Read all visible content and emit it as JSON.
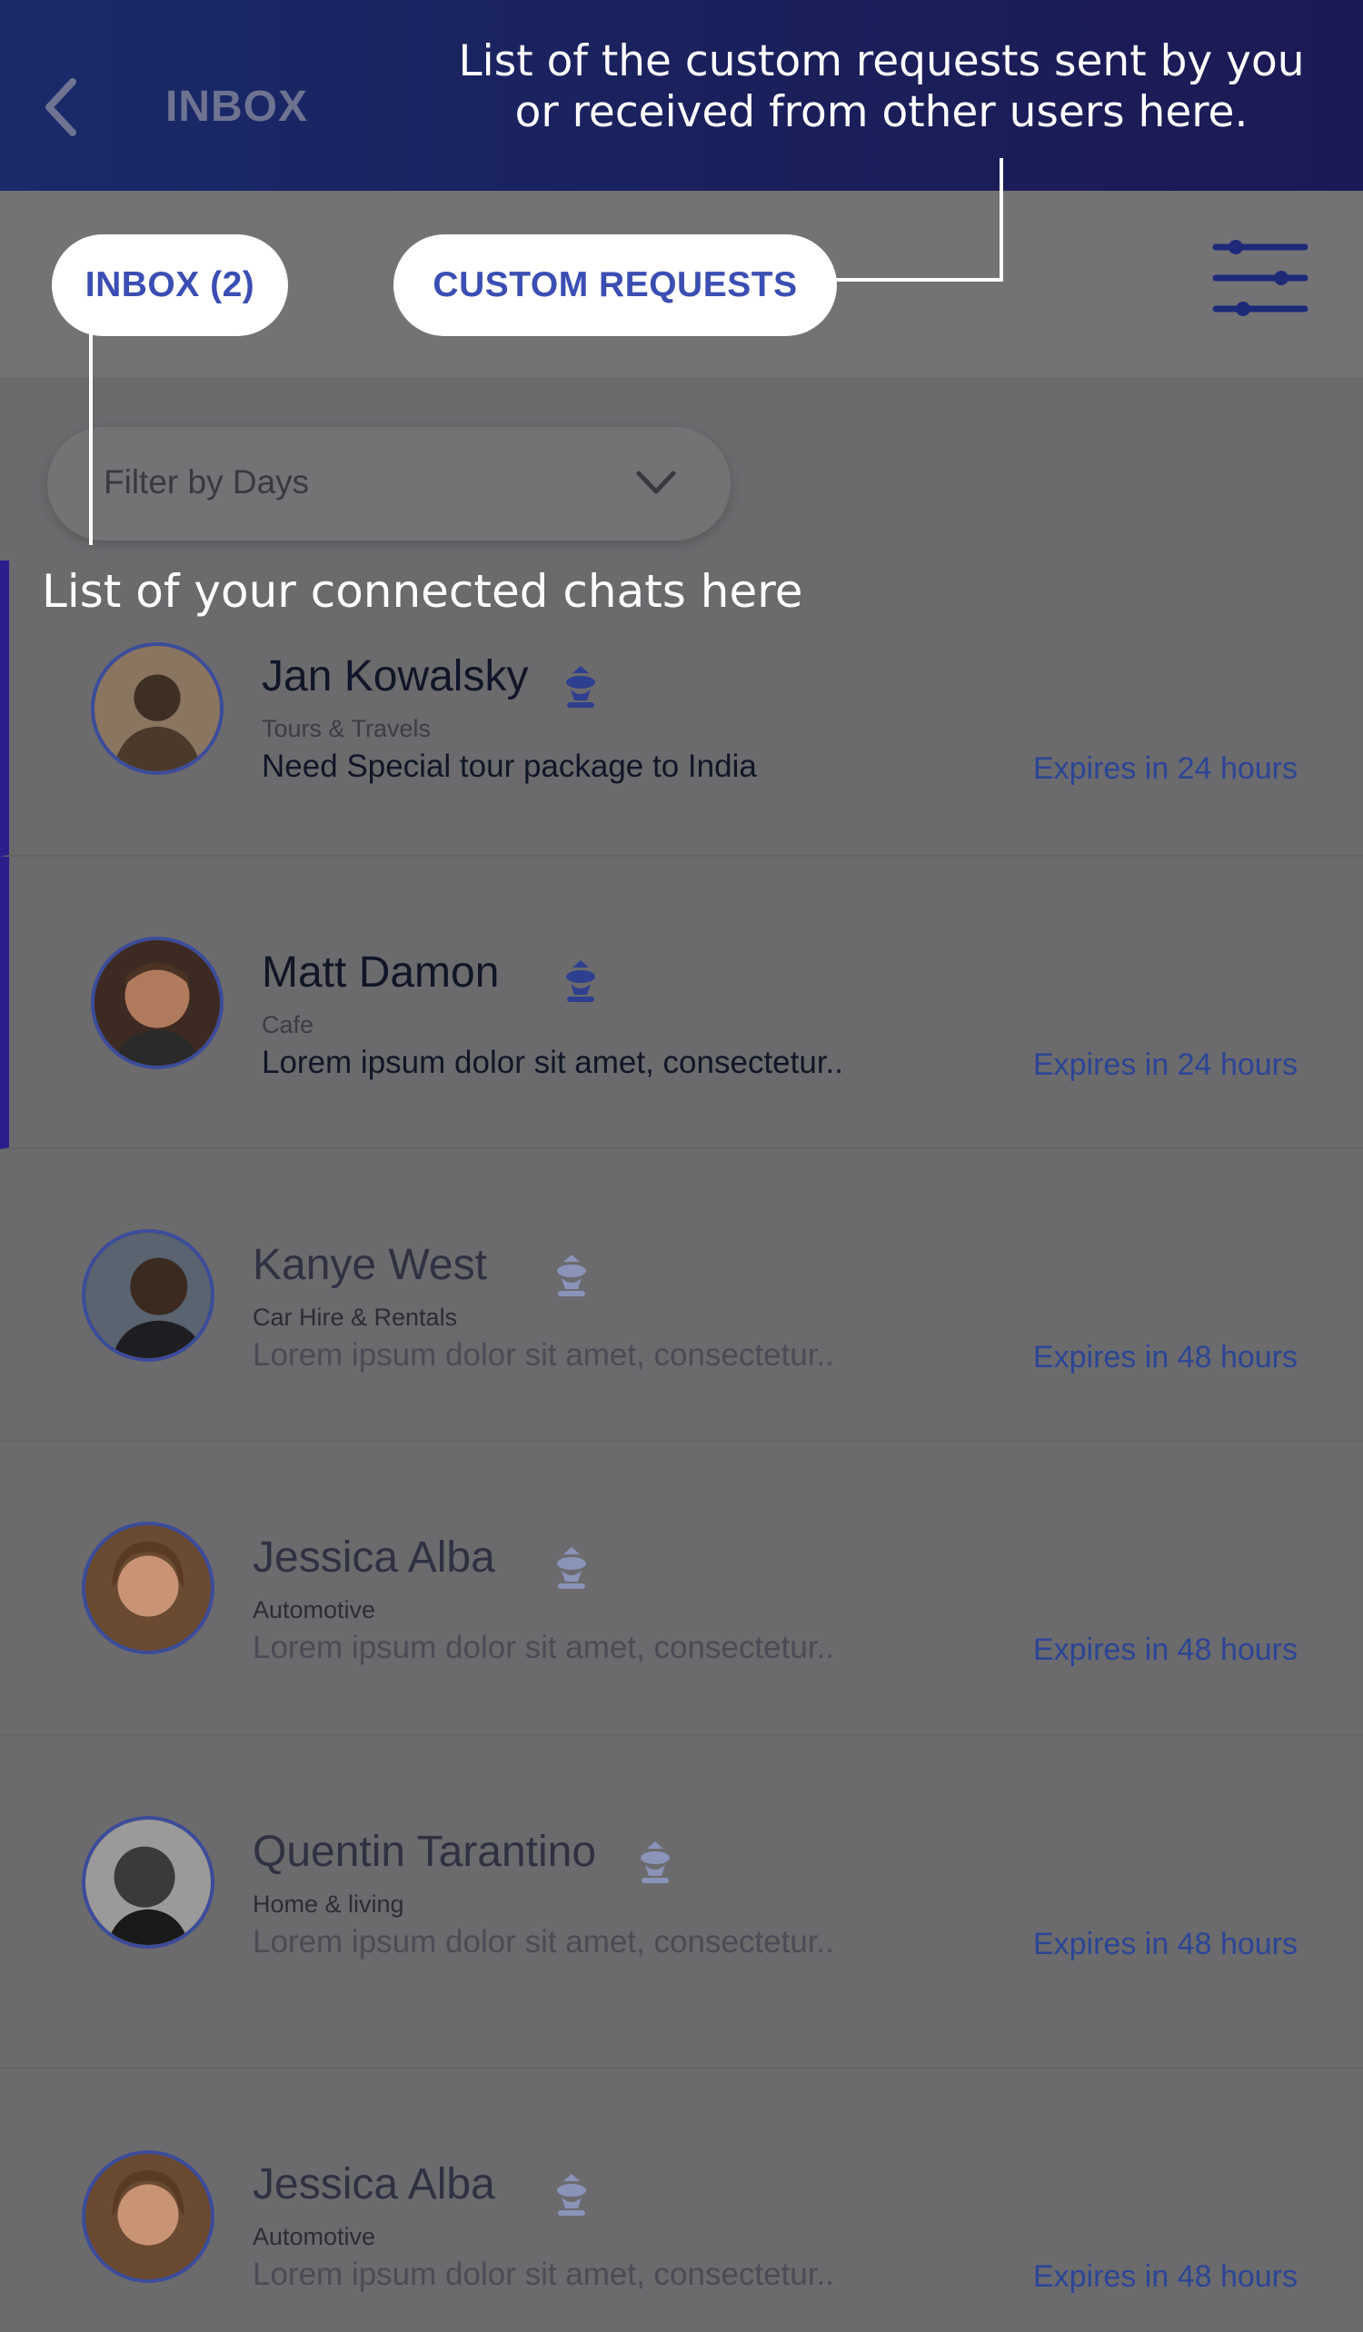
{
  "header": {
    "title": "INBOX",
    "back_icon": "chevron-left-icon"
  },
  "tabs": {
    "inbox_label": "INBOX (2)",
    "custom_requests_label": "CUSTOM REQUESTS",
    "filter_icon": "sliders-icon"
  },
  "filter": {
    "label": "Filter by Days",
    "icon": "chevron-down-icon"
  },
  "annotations": {
    "custom_requests_line1": "List of the custom requests sent by you",
    "custom_requests_line2": "or received from other users here.",
    "chats": "List of your connected chats here"
  },
  "chats": [
    {
      "name": "Jan Kowalsky",
      "category": "Tours & Travels",
      "message": "Need Special tour package to India",
      "expiry": "Expires in 24 hours",
      "unread": true
    },
    {
      "name": "Matt Damon",
      "category": "Cafe",
      "message": "Lorem ipsum dolor sit amet, consectetur..",
      "expiry": "Expires in 24 hours",
      "unread": true
    },
    {
      "name": "Kanye West",
      "category": "Car Hire & Rentals",
      "message": "Lorem ipsum dolor sit amet, consectetur..",
      "expiry": "Expires in 48 hours",
      "unread": false
    },
    {
      "name": "Jessica Alba",
      "category": "Automotive",
      "message": "Lorem ipsum dolor sit amet, consectetur..",
      "expiry": "Expires in 48 hours",
      "unread": false
    },
    {
      "name": "Quentin Tarantino",
      "category": "Home & living",
      "message": "Lorem ipsum dolor sit amet, consectetur..",
      "expiry": "Expires in 48 hours",
      "unread": false
    },
    {
      "name": "Jessica Alba",
      "category": "Automotive",
      "message": "Lorem ipsum dolor sit amet, consectetur..",
      "expiry": "Expires in 48 hours",
      "unread": false
    }
  ],
  "colors": {
    "header_bg": "#1a2a6a",
    "accent": "#3b4eb3",
    "active_indicator": "#2b1d8c",
    "expiry_text": "#2c4594"
  }
}
